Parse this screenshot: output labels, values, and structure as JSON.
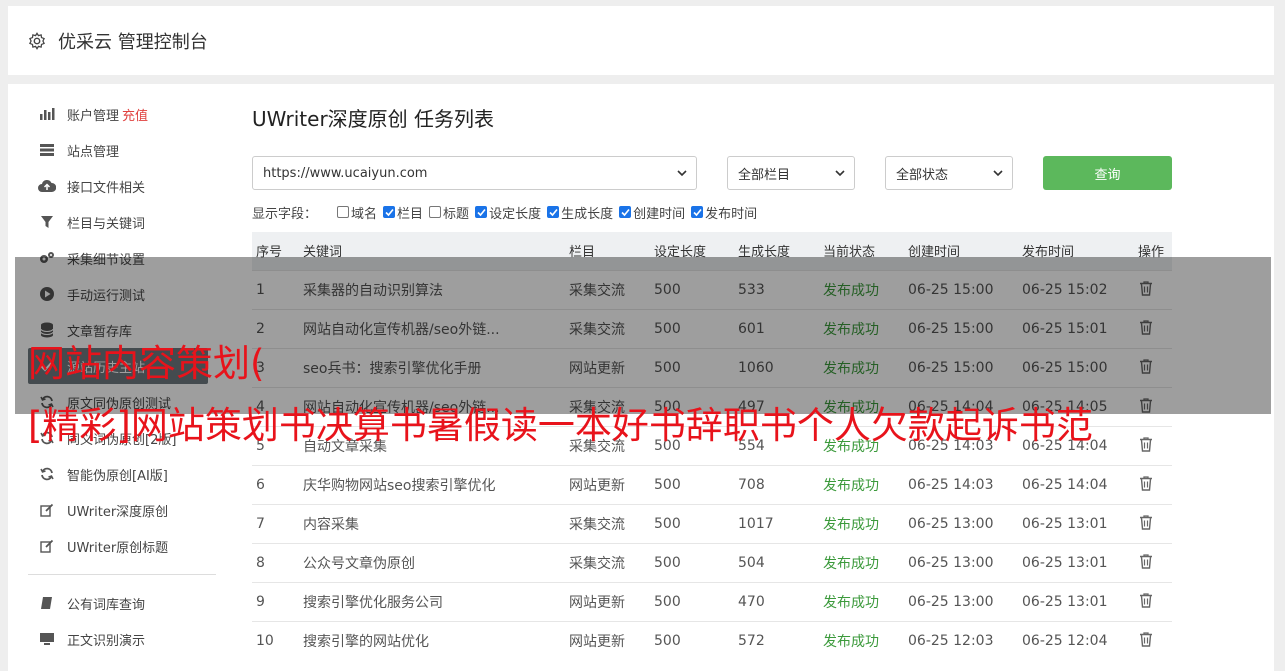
{
  "header": {
    "title": "优采云 管理控制台"
  },
  "sidebar": {
    "items": [
      {
        "label": "账户管理",
        "extra": "充值",
        "icon": "bar-chart-icon"
      },
      {
        "label": "站点管理",
        "icon": "server-icon"
      },
      {
        "label": "接口文件相关",
        "icon": "cloud-upload-icon"
      },
      {
        "label": "栏目与关键词",
        "icon": "filter-icon"
      },
      {
        "label": "采集细节设置",
        "icon": "cogs-icon"
      },
      {
        "label": "手动运行测试",
        "icon": "play-circle-icon"
      },
      {
        "label": "文章暂存库",
        "icon": "database-icon"
      },
      {
        "label": "源站历史主站",
        "icon": "check-icon"
      },
      {
        "label": "原文同伪原创测试",
        "icon": "refresh-icon"
      },
      {
        "label": "同义词伪原创[2版]",
        "icon": "refresh-icon"
      },
      {
        "label": "智能伪原创[AI版]",
        "icon": "refresh-icon"
      },
      {
        "label": "UWriter深度原创",
        "icon": "edit-icon"
      },
      {
        "label": "UWriter原创标题",
        "icon": "edit-icon"
      },
      {
        "label": "公有词库查询",
        "icon": "book-icon"
      },
      {
        "label": "正文识别演示",
        "icon": "desktop-icon"
      }
    ]
  },
  "main": {
    "title": "UWriter深度原创 任务列表",
    "filters": {
      "site": "https://www.ucaiyun.com",
      "column": "全部栏目",
      "status": "全部状态",
      "query_label": "查询"
    },
    "fields": {
      "label": "显示字段：",
      "options": [
        {
          "label": "域名",
          "checked": false
        },
        {
          "label": "栏目",
          "checked": true
        },
        {
          "label": "标题",
          "checked": false
        },
        {
          "label": "设定长度",
          "checked": true
        },
        {
          "label": "生成长度",
          "checked": true
        },
        {
          "label": "创建时间",
          "checked": true
        },
        {
          "label": "发布时间",
          "checked": true
        }
      ]
    },
    "table": {
      "headers": [
        "序号",
        "关键词",
        "栏目",
        "设定长度",
        "生成长度",
        "当前状态",
        "创建时间",
        "发布时间",
        "操作"
      ],
      "rows": [
        [
          "1",
          "采集器的自动识别算法",
          "采集交流",
          "500",
          "533",
          "发布成功",
          "06-25 15:00",
          "06-25 15:02"
        ],
        [
          "2",
          "网站自动化宣传机器/seo外链...",
          "采集交流",
          "500",
          "601",
          "发布成功",
          "06-25 15:00",
          "06-25 15:01"
        ],
        [
          "3",
          "seo兵书：搜索引擎优化手册",
          "网站更新",
          "500",
          "1060",
          "发布成功",
          "06-25 15:00",
          "06-25 15:00"
        ],
        [
          "4",
          "网站自动化宣传机器/seo外链...",
          "采集交流",
          "500",
          "497",
          "发布成功",
          "06-25 14:04",
          "06-25 14:05"
        ],
        [
          "5",
          "自动文章采集",
          "采集交流",
          "500",
          "554",
          "发布成功",
          "06-25 14:03",
          "06-25 14:04"
        ],
        [
          "6",
          "庆华购物网站seo搜索引擎优化",
          "网站更新",
          "500",
          "708",
          "发布成功",
          "06-25 14:03",
          "06-25 14:04"
        ],
        [
          "7",
          "内容采集",
          "采集交流",
          "500",
          "1017",
          "发布成功",
          "06-25 13:00",
          "06-25 13:01"
        ],
        [
          "8",
          "公众号文章伪原创",
          "采集交流",
          "500",
          "504",
          "发布成功",
          "06-25 13:00",
          "06-25 13:01"
        ],
        [
          "9",
          "搜索引擎优化服务公司",
          "网站更新",
          "500",
          "470",
          "发布成功",
          "06-25 13:00",
          "06-25 13:01"
        ],
        [
          "10",
          "搜索引擎的网站优化",
          "网站更新",
          "500",
          "572",
          "发布成功",
          "06-25 12:03",
          "06-25 12:04"
        ]
      ]
    }
  },
  "overlay": {
    "line1": "网站内容策划(",
    "line2": "[精彩]网站策划书决算书暑假读一本好书辞职书个人欠款起诉书范"
  },
  "colors": {
    "accent_green": "#5cb85c",
    "status_green": "#3c9a3c",
    "recharge_red": "#e0413f",
    "overlay_red": "#e8131b"
  }
}
